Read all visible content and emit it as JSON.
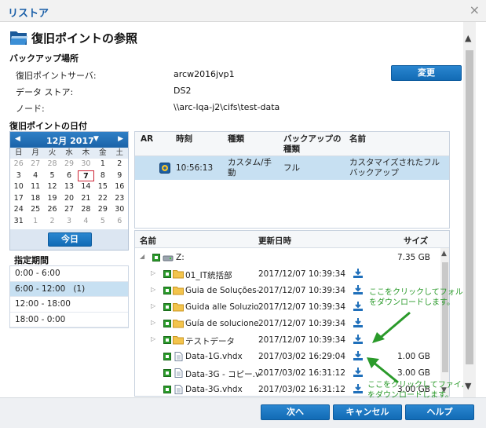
{
  "window": {
    "title": "リストア"
  },
  "header": {
    "title": "復旧ポイントの参照"
  },
  "backup_location": {
    "section_label": "バックアップ場所",
    "server_label": "復旧ポイントサーバ:",
    "server_value": "arcw2016jvp1",
    "datastore_label": "データ ストア:",
    "datastore_value": "DS2",
    "node_label": "ノード:",
    "node_value": "\\\\arc-lqa-j2\\cifs\\test-data",
    "change_button": "変更"
  },
  "date_section": {
    "label": "復旧ポイントの日付"
  },
  "calendar": {
    "month_label": "12月 2017",
    "prev_icon": "◀",
    "next_icon": "▶",
    "dropdown_icon": "▼",
    "weekdays": [
      "日",
      "月",
      "火",
      "水",
      "木",
      "金",
      "土"
    ],
    "days": [
      {
        "d": "26",
        "o": true
      },
      {
        "d": "27",
        "o": true
      },
      {
        "d": "28",
        "o": true
      },
      {
        "d": "29",
        "o": true
      },
      {
        "d": "30",
        "o": true
      },
      {
        "d": "1"
      },
      {
        "d": "2"
      },
      {
        "d": "3"
      },
      {
        "d": "4"
      },
      {
        "d": "5"
      },
      {
        "d": "6"
      },
      {
        "d": "7",
        "sel": true
      },
      {
        "d": "8"
      },
      {
        "d": "9"
      },
      {
        "d": "10"
      },
      {
        "d": "11"
      },
      {
        "d": "12"
      },
      {
        "d": "13"
      },
      {
        "d": "14"
      },
      {
        "d": "15"
      },
      {
        "d": "16"
      },
      {
        "d": "17"
      },
      {
        "d": "18"
      },
      {
        "d": "19"
      },
      {
        "d": "20"
      },
      {
        "d": "21"
      },
      {
        "d": "22"
      },
      {
        "d": "23"
      },
      {
        "d": "24"
      },
      {
        "d": "25"
      },
      {
        "d": "26"
      },
      {
        "d": "27"
      },
      {
        "d": "28"
      },
      {
        "d": "29"
      },
      {
        "d": "30"
      },
      {
        "d": "31"
      },
      {
        "d": "1",
        "o": true
      },
      {
        "d": "2",
        "o": true
      },
      {
        "d": "3",
        "o": true
      },
      {
        "d": "4",
        "o": true
      },
      {
        "d": "5",
        "o": true
      },
      {
        "d": "6",
        "o": true
      }
    ],
    "today_button": "今日"
  },
  "period": {
    "label": "指定期間",
    "items": [
      {
        "text": "0:00 - 6:00",
        "active": false
      },
      {
        "text": "6:00 - 12:00   (1)",
        "active": true
      },
      {
        "text": "12:00 - 18:00",
        "active": false
      },
      {
        "text": "18:00 - 0:00",
        "active": false
      }
    ]
  },
  "rp_table": {
    "col_ar": "AR",
    "col_time": "時刻",
    "col_type": "種類",
    "col_backup_type": "バックアップの\n種類",
    "col_name": "名前",
    "row": {
      "time": "10:56:13",
      "type": "カスタム/手\n動",
      "backup_type": "フル",
      "name": "カスタマイズされたフル\nバックアップ"
    }
  },
  "tree": {
    "col_name": "名前",
    "col_modified": "更新日時",
    "col_size": "サイズ",
    "root": {
      "name": "Z:",
      "size": "7.35 GB"
    },
    "rows": [
      {
        "name": "01_IT統括部",
        "date": "2017/12/07 10:39:34",
        "size": "",
        "kind": "folder"
      },
      {
        "name": "Guia de Soluções-l",
        "date": "2017/12/07 10:39:34",
        "size": "",
        "kind": "folder"
      },
      {
        "name": "Guida alle Soluzion",
        "date": "2017/12/07 10:39:34",
        "size": "",
        "kind": "folder"
      },
      {
        "name": "Guía de soluciones",
        "date": "2017/12/07 10:39:34",
        "size": "",
        "kind": "folder"
      },
      {
        "name": "テストデータ",
        "date": "2017/12/07 10:39:34",
        "size": "",
        "kind": "folder"
      },
      {
        "name": "Data-1G.vhdx",
        "date": "2017/03/02 16:29:04",
        "size": "1.00 GB",
        "kind": "file"
      },
      {
        "name": "Data-3G - コピー.v",
        "date": "2017/03/02 16:31:12",
        "size": "3.00 GB",
        "kind": "file"
      },
      {
        "name": "Data-3G.vhdx",
        "date": "2017/03/02 16:31:12",
        "size": "3.00 GB",
        "kind": "file"
      }
    ]
  },
  "annotations": {
    "folder_note": "ここをクリックしてフォルダ\nをダウンロードします。",
    "file_note": "ここをクリックしてファイル\nをダウンロードします。"
  },
  "footer": {
    "next_button": "次へ",
    "cancel_button": "キャンセル",
    "help_button": "ヘルプ"
  },
  "colors": {
    "accent": "#1a6fbf",
    "selection": "#c7e0f2",
    "annotation": "#2a9a2a"
  }
}
